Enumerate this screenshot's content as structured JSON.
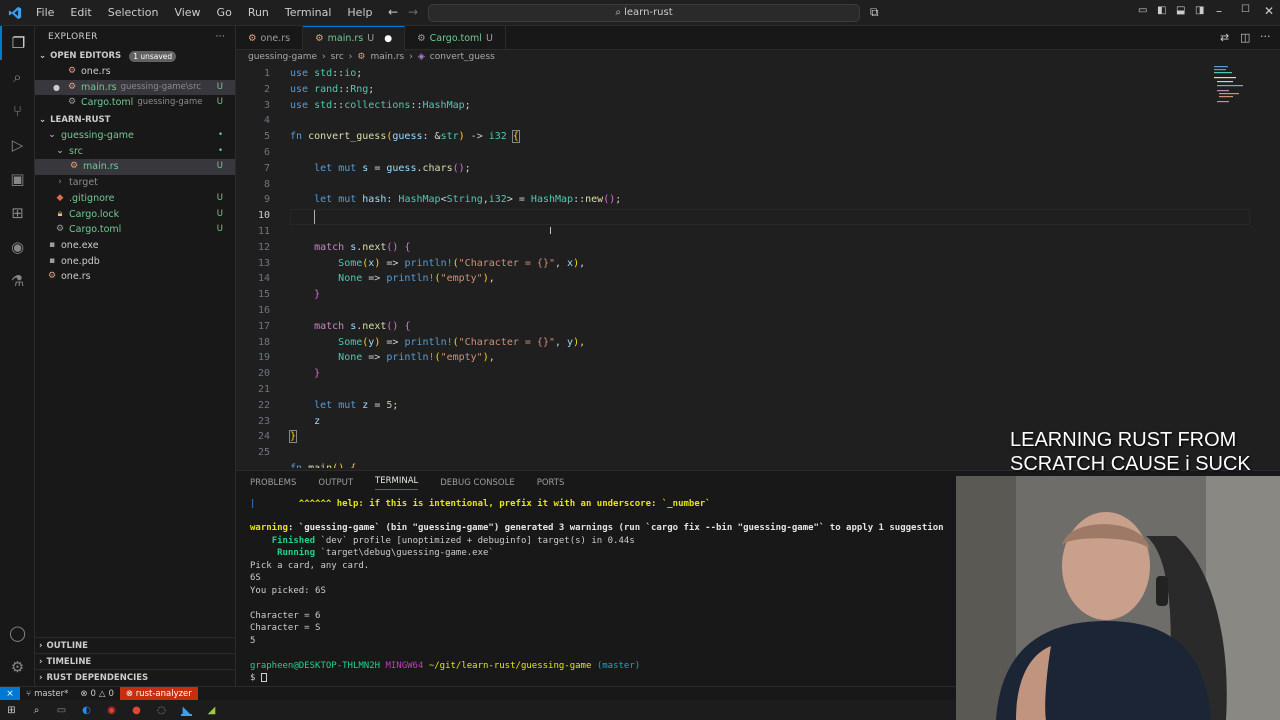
{
  "window": {
    "menu": [
      "File",
      "Edit",
      "Selection",
      "View",
      "Go",
      "Run",
      "Terminal",
      "Help"
    ],
    "search": "learn-rust"
  },
  "explorer": {
    "title": "EXPLORER",
    "open_editors": {
      "label": "OPEN EDITORS",
      "badge": "1 unsaved",
      "items": [
        {
          "name": "one.rs",
          "desc": "",
          "status": ""
        },
        {
          "name": "main.rs",
          "desc": "guessing-game\\src",
          "status": "U"
        },
        {
          "name": "Cargo.toml",
          "desc": "guessing-game",
          "status": "U"
        }
      ]
    },
    "workspace": {
      "label": "LEARN-RUST",
      "items": [
        {
          "name": "guessing-game",
          "status": "•"
        },
        {
          "name": "src",
          "status": "•"
        },
        {
          "name": "main.rs",
          "status": "U"
        },
        {
          "name": "target",
          "status": ""
        },
        {
          "name": ".gitignore",
          "status": "U"
        },
        {
          "name": "Cargo.lock",
          "status": "U"
        },
        {
          "name": "Cargo.toml",
          "status": "U"
        },
        {
          "name": "one.exe",
          "status": ""
        },
        {
          "name": "one.pdb",
          "status": ""
        },
        {
          "name": "one.rs",
          "status": ""
        }
      ]
    },
    "bottom_sections": [
      "OUTLINE",
      "TIMELINE",
      "RUST DEPENDENCIES"
    ]
  },
  "tabs": [
    {
      "name": "one.rs",
      "status": ""
    },
    {
      "name": "main.rs",
      "status": "U"
    },
    {
      "name": "Cargo.toml",
      "status": "U"
    }
  ],
  "breadcrumb": [
    "guessing-game",
    "src",
    "main.rs",
    "convert_guess"
  ],
  "line_numbers": [
    "1",
    "2",
    "3",
    "4",
    "5",
    "6",
    "7",
    "8",
    "9",
    "10",
    "11",
    "12",
    "13",
    "14",
    "15",
    "16",
    "17",
    "18",
    "19",
    "20",
    "21",
    "22",
    "23",
    "24",
    "25"
  ],
  "panel": {
    "tabs": [
      "PROBLEMS",
      "OUTPUT",
      "TERMINAL",
      "DEBUG CONSOLE",
      "PORTS"
    ],
    "terminal": {
      "help_line": "^^^^^^ help: if this is intentional, prefix it with an underscore: `_number`",
      "warning_label": "warning",
      "warning_text": ": `guessing-game` (bin \"guessing-game\") generated 3 warnings (run `cargo fix --bin \"guessing-game\"` to apply 1 suggestion",
      "finished_label": "Finished",
      "finished_text": " `dev` profile [unoptimized + debuginfo] target(s) in 0.44s",
      "running_label": "Running",
      "running_text": " `target\\debug\\guessing-game.exe`",
      "output": [
        "Pick a card, any card.",
        "6S",
        "You picked: 6S",
        "",
        "Character = 6",
        "Character = S",
        "5"
      ],
      "prompt_user": "grapheen@DESKTOP-THLMN2H",
      "prompt_shell": "MINGW64",
      "prompt_path": "~/git/learn-rust/guessing-game",
      "prompt_branch": "(master)",
      "prompt_symbol": "$"
    }
  },
  "statusbar": {
    "branch": "master*",
    "errors": "0",
    "warnings": "0",
    "rust_analyzer": "rust-analyzer"
  },
  "overlay": {
    "line1": "LEARNING RUST FROM",
    "line2": "SCRATCH CAUSE i SUCK"
  }
}
